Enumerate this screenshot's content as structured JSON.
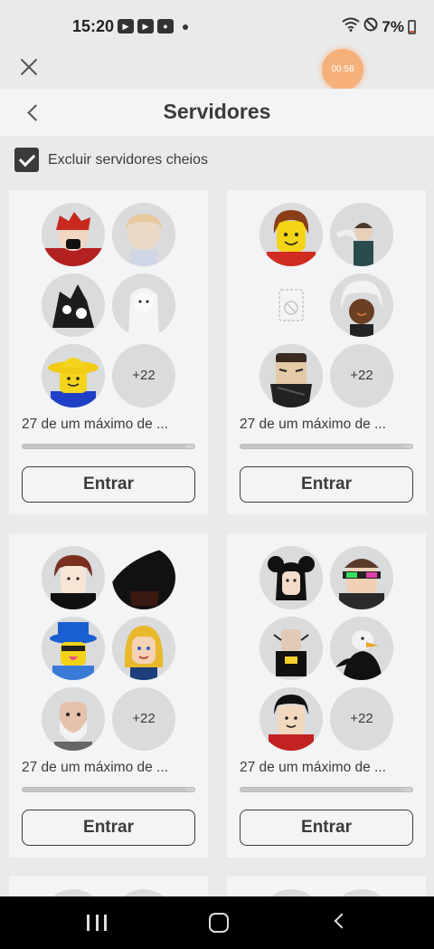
{
  "status_bar": {
    "time": "15:20",
    "battery": "7%"
  },
  "recording": {
    "time": "00:58"
  },
  "header": {
    "title": "Servidores"
  },
  "filter": {
    "label": "Excluir servidores cheios",
    "checked": true
  },
  "servers": [
    {
      "players_text": "27 de um máximo de ...",
      "more": "+22",
      "join_label": "Entrar",
      "fill": 0.95
    },
    {
      "players_text": "27 de um máximo de ...",
      "more": "+22",
      "join_label": "Entrar",
      "fill": 0.95
    },
    {
      "players_text": "27 de um máximo de ...",
      "more": "+22",
      "join_label": "Entrar",
      "fill": 0.95
    },
    {
      "players_text": "27 de um máximo de ...",
      "more": "+22",
      "join_label": "Entrar",
      "fill": 0.95
    }
  ],
  "colors": {
    "background": "#e9ebeb",
    "card": "#f2f4f5",
    "text": "#393b3d",
    "avatar_bg": "#d9dbdc"
  }
}
